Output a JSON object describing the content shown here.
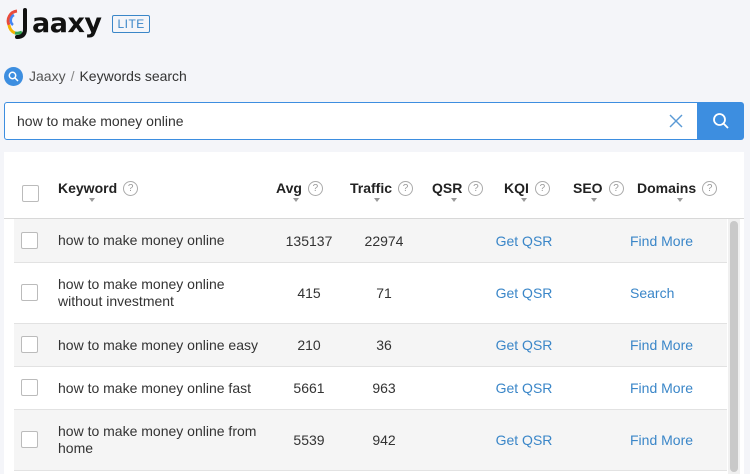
{
  "app": {
    "name": "Jaaxy",
    "logo_text": "aaxy",
    "edition": "LITE"
  },
  "breadcrumb": {
    "root": "Jaaxy",
    "separator": "/",
    "current": "Keywords search"
  },
  "search": {
    "value": "how to make money online"
  },
  "icons": {
    "search": "search-icon",
    "clear": "close-icon",
    "help": "help-circle-icon",
    "sort": "sort-caret-icon"
  },
  "colors": {
    "accent": "#3d8ee0",
    "link": "#3a86c8"
  },
  "table": {
    "columns": [
      {
        "key": "keyword",
        "label": "Keyword"
      },
      {
        "key": "avg",
        "label": "Avg"
      },
      {
        "key": "traffic",
        "label": "Traffic"
      },
      {
        "key": "qsr",
        "label": "QSR"
      },
      {
        "key": "kqi",
        "label": "KQI"
      },
      {
        "key": "seo",
        "label": "SEO"
      },
      {
        "key": "domains",
        "label": "Domains"
      }
    ],
    "help_glyph": "?",
    "rows": [
      {
        "keyword": "how to make money online",
        "avg": "135137",
        "traffic": "22974",
        "qsr": "Get QSR",
        "domains": "Find More"
      },
      {
        "keyword": "how to make money online without investment",
        "avg": "415",
        "traffic": "71",
        "qsr": "Get QSR",
        "domains": "Search"
      },
      {
        "keyword": "how to make money online easy",
        "avg": "210",
        "traffic": "36",
        "qsr": "Get QSR",
        "domains": "Find More"
      },
      {
        "keyword": "how to make money online fast",
        "avg": "5661",
        "traffic": "963",
        "qsr": "Get QSR",
        "domains": "Find More"
      },
      {
        "keyword": "how to make money online from home",
        "avg": "5539",
        "traffic": "942",
        "qsr": "Get QSR",
        "domains": "Find More"
      }
    ]
  }
}
